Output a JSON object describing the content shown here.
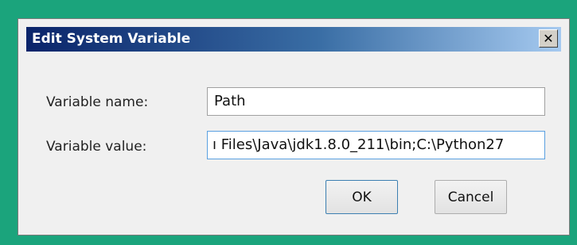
{
  "window": {
    "title": "Edit System Variable",
    "close_icon": "close-icon"
  },
  "fields": {
    "name_label": "Variable name:",
    "name_value": "Path",
    "value_label": "Variable value:",
    "value_value": "ı Files\\Java\\jdk1.8.0_211\\bin;C:\\Python27"
  },
  "buttons": {
    "ok": "OK",
    "cancel": "Cancel"
  },
  "colors": {
    "page_background": "#1ba47c",
    "titlebar_start": "#0a246a",
    "titlebar_end": "#a6caf0",
    "dialog_background": "#f0f0f0"
  }
}
